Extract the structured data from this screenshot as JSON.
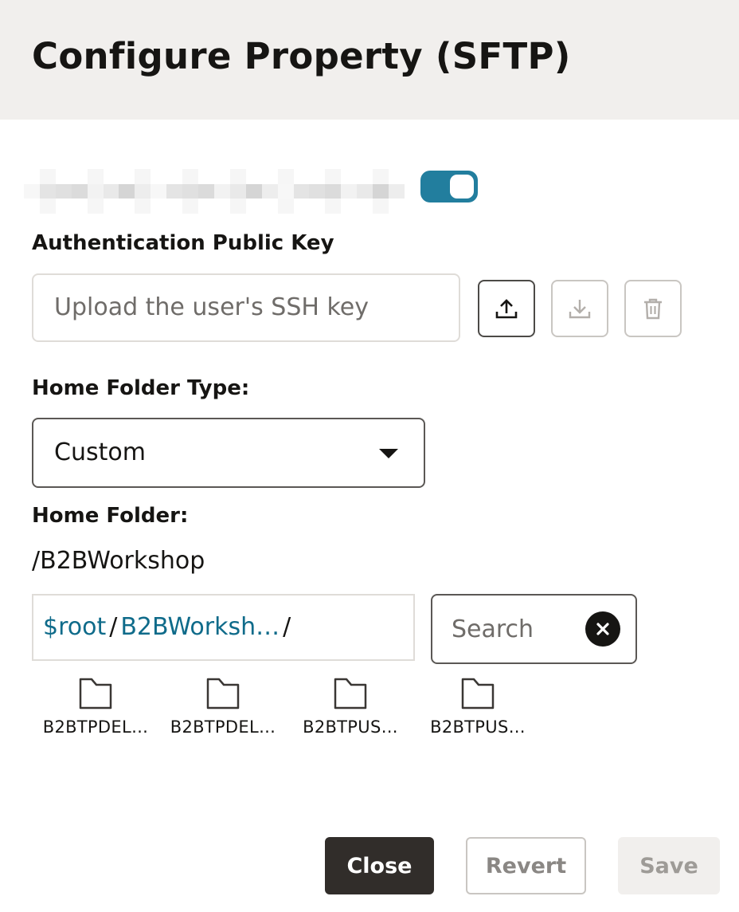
{
  "dialog": {
    "title": "Configure Property (SFTP)"
  },
  "toggle": {
    "on": true,
    "accent_color": "#227e9e"
  },
  "auth_key": {
    "label": "Authentication Public Key",
    "placeholder": "Upload the user's SSH key",
    "actions": [
      {
        "icon": "upload-icon",
        "enabled": true
      },
      {
        "icon": "download-icon",
        "enabled": false
      },
      {
        "icon": "trash-icon",
        "enabled": false
      }
    ]
  },
  "home_folder_type": {
    "label": "Home Folder Type:",
    "selected": "Custom"
  },
  "home_folder": {
    "label": "Home Folder:",
    "value": "/B2BWorkshop",
    "path": {
      "root": "$root",
      "segment": "B2BWorksh…",
      "separator": "/"
    },
    "search_placeholder": "Search",
    "folders": [
      {
        "name": "B2BTPDEL…"
      },
      {
        "name": "B2BTPDEL…"
      },
      {
        "name": "B2BTPUS…"
      },
      {
        "name": "B2BTPUS…"
      }
    ]
  },
  "footer": {
    "close_label": "Close",
    "revert_label": "Revert",
    "save_label": "Save"
  },
  "colors": {
    "header_bg": "#f1efed",
    "link": "#0f6b8a",
    "primary_button": "#312d2a"
  }
}
